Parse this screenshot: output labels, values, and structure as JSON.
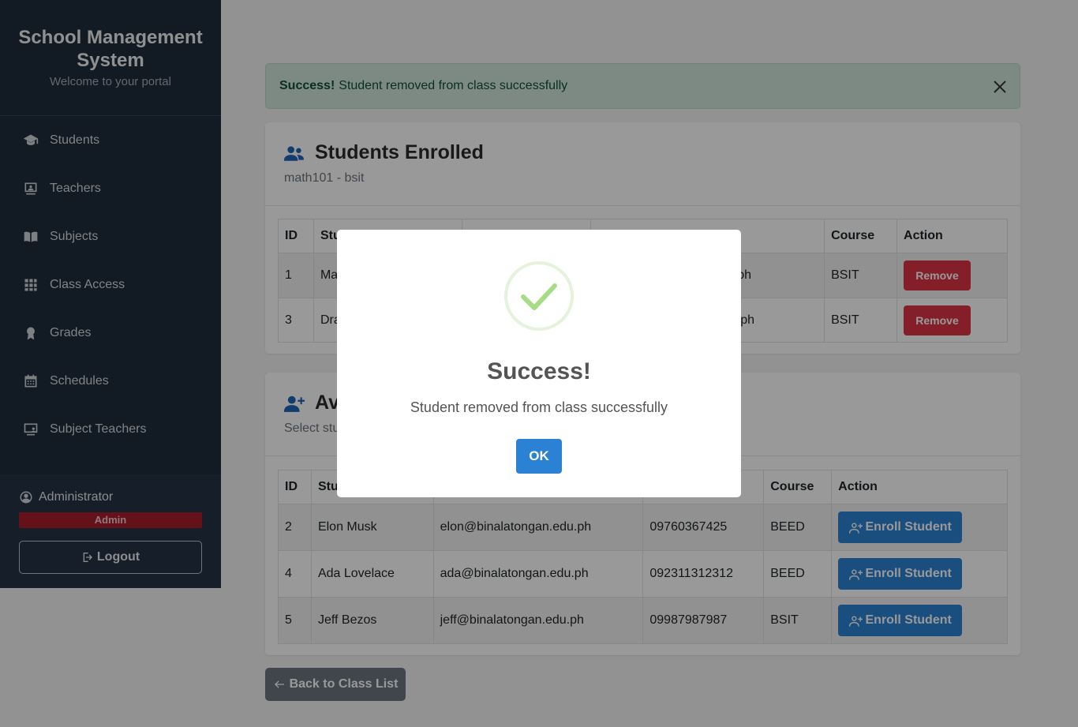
{
  "sidebar": {
    "title": "School Management System",
    "subtitle": "Welcome to your portal",
    "items": [
      {
        "label": "Students",
        "icon": "graduation-cap-icon"
      },
      {
        "label": "Teachers",
        "icon": "chalkboard-teacher-icon"
      },
      {
        "label": "Subjects",
        "icon": "book-open-icon"
      },
      {
        "label": "Class Access",
        "icon": "grid-icon"
      },
      {
        "label": "Grades",
        "icon": "award-icon"
      },
      {
        "label": "Schedules",
        "icon": "calendar-icon"
      },
      {
        "label": "Subject Teachers",
        "icon": "monitor-person-icon"
      }
    ],
    "user": {
      "name": "Administrator",
      "role": "Admin"
    },
    "logout_label": "Logout"
  },
  "alert": {
    "strong": "Success!",
    "message": "Student removed from class successfully"
  },
  "enrolled": {
    "title": "Students Enrolled",
    "subtitle": "math101 - bsit",
    "headers": [
      "ID",
      "Stu",
      "",
      "",
      "Course",
      "Action"
    ],
    "rows": [
      {
        "id": "1",
        "name": "Ma",
        "email_tail": "ph",
        "course": "BSIT",
        "action": "Remove"
      },
      {
        "id": "3",
        "name": "Dra",
        "email_tail": "ph",
        "course": "BSIT",
        "action": "Remove"
      }
    ]
  },
  "available": {
    "title": "Av",
    "subtitle": "Select stu",
    "headers": [
      "ID",
      "Stu",
      "",
      "",
      "Course",
      "Action"
    ],
    "rows": [
      {
        "id": "2",
        "name": "Elon Musk",
        "email": "elon@binalatongan.edu.ph",
        "phone": "09760367425",
        "course": "BEED",
        "action": "Enroll Student"
      },
      {
        "id": "4",
        "name": "Ada Lovelace",
        "email": "ada@binalatongan.edu.ph",
        "phone": "092311312312",
        "course": "BEED",
        "action": "Enroll Student"
      },
      {
        "id": "5",
        "name": "Jeff Bezos",
        "email": "jeff@binalatongan.edu.ph",
        "phone": "09987987987",
        "course": "BSIT",
        "action": "Enroll Student"
      }
    ]
  },
  "back_label": "Back to Class List",
  "modal": {
    "title": "Success!",
    "text": "Student removed from class successfully",
    "ok_label": "OK"
  },
  "colors": {
    "sidebar": "#1f2d3d",
    "primary": "#2b82d4",
    "danger": "#dc3545",
    "success_bg": "#d1e7dd"
  }
}
